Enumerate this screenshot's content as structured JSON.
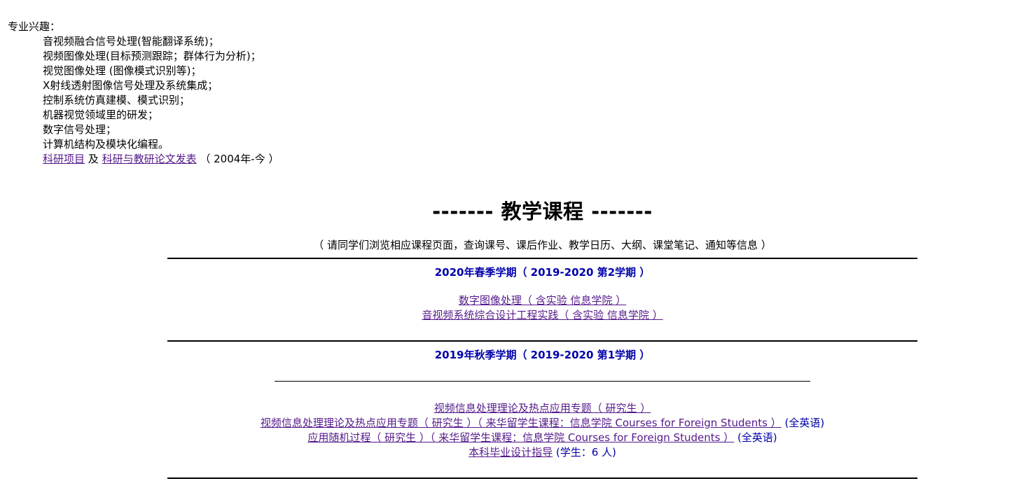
{
  "interests": {
    "heading": "专业兴趣：",
    "items": [
      "音视频融合信号处理(智能翻译系统)；",
      "视频图像处理(目标预测跟踪；群体行为分析)；",
      "视觉图像处理 (图像模式识别等)；",
      "X射线透射图像信号处理及系统集成；",
      "控制系统仿真建模、模式识别；",
      "机器视觉领域里的研发；",
      "数字信号处理；",
      "计算机结构及模块化编程。"
    ],
    "links": {
      "research_projects": "科研项目",
      "and": " 及 ",
      "papers": "科研与教研论文发表",
      "period": " （ 2004年-今 ）"
    }
  },
  "teaching": {
    "title": "------- 教学课程 -------",
    "note": "（ 请同学们浏览相应课程页面，查询课号、课后作业、教学日历、大纲、课堂笔记、通知等信息 ）",
    "terms": [
      {
        "name": "2020年春季学期（ 2019-2020 第2学期 ）",
        "courses": [
          {
            "text": "数字图像处理（ 含实验 信息学院 ）",
            "extra": ""
          },
          {
            "text": "音视频系统综合设计工程实践（ 含实验 信息学院 ）",
            "extra": ""
          }
        ]
      },
      {
        "name": "2019年秋季学期（ 2019-2020 第1学期 ）",
        "courses": [
          {
            "text": "视频信息处理理论及热点应用专题（ 研究生 ）",
            "extra": ""
          },
          {
            "text": "视频信息处理理论及热点应用专题（ 研究生 ）（ 来华留学生课程：信息学院 Courses for Foreign Students ）",
            "extra": " (全英语)"
          },
          {
            "text": "应用随机过程（ 研究生 ）（ 来华留学生课程：信息学院 Courses for Foreign Students ）",
            "extra": " (全英语)"
          },
          {
            "text": "本科毕业设计指导",
            "extra": " (学生：6 人)"
          }
        ]
      }
    ]
  }
}
